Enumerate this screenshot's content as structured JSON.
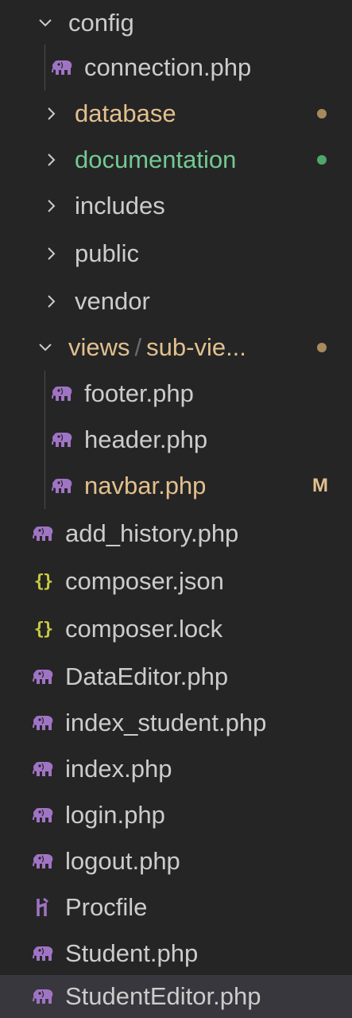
{
  "colors": {
    "default_text": "#cccccc",
    "modified_text": "#e2c08d",
    "untracked_text": "#73c991",
    "php_icon": "#a074c4",
    "json_icon": "#cbcb41",
    "procfile_icon": "#a074c4",
    "modified_dot": "#a88a5c",
    "untracked_dot": "#50a66b",
    "selected_row": "#37373d"
  },
  "tree": {
    "config": {
      "label": "config"
    },
    "connection": {
      "label": "connection.php"
    },
    "database": {
      "label": "database"
    },
    "documentation": {
      "label": "documentation"
    },
    "includes": {
      "label": "includes"
    },
    "public": {
      "label": "public"
    },
    "vendor": {
      "label": "vendor"
    },
    "views": {
      "label": "views",
      "separator": "/",
      "sub_label": "sub-vie..."
    },
    "footer": {
      "label": "footer.php"
    },
    "header": {
      "label": "header.php"
    },
    "navbar": {
      "label": "navbar.php",
      "status": "M"
    },
    "add_history": {
      "label": "add_history.php"
    },
    "composer_json": {
      "label": "composer.json",
      "icon_text": "{}"
    },
    "composer_lock": {
      "label": "composer.lock",
      "icon_text": "{}"
    },
    "data_editor": {
      "label": "DataEditor.php"
    },
    "index_student": {
      "label": "index_student.php"
    },
    "index": {
      "label": "index.php"
    },
    "login": {
      "label": "login.php"
    },
    "logout": {
      "label": "logout.php"
    },
    "procfile": {
      "label": "Procfile"
    },
    "student": {
      "label": "Student.php"
    },
    "student_editor": {
      "label": "StudentEditor.php"
    }
  }
}
